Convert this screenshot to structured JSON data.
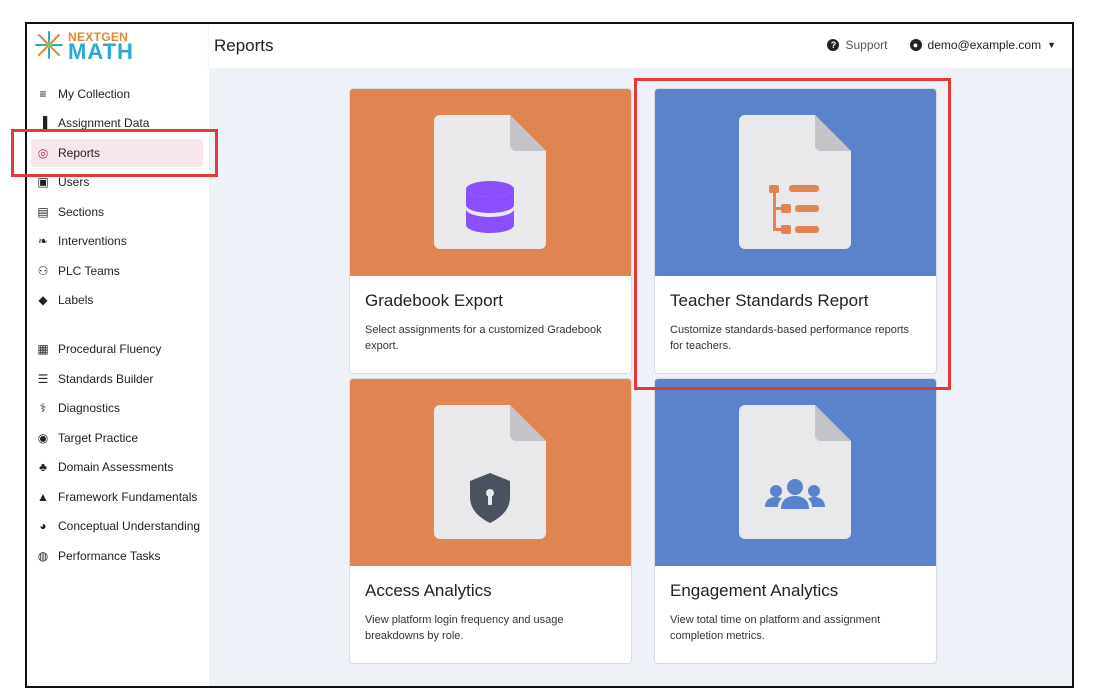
{
  "app": {
    "logo_top": "NEXTGEN",
    "logo_bottom": "MATH",
    "page_title": "Reports"
  },
  "topbar": {
    "support_label": "Support",
    "user_email": "demo@example.com"
  },
  "sidebar": {
    "items": [
      {
        "label": "My Collection",
        "icon": "library-icon",
        "glyph": "≡"
      },
      {
        "label": "Assignment Data",
        "icon": "bar-chart-icon",
        "glyph": "▐"
      },
      {
        "label": "Reports",
        "icon": "magnify-chart-icon",
        "glyph": "◎",
        "active": true
      },
      {
        "label": "Users",
        "icon": "id-card-icon",
        "glyph": "▣"
      },
      {
        "label": "Sections",
        "icon": "chalkboard-icon",
        "glyph": "▤"
      },
      {
        "label": "Interventions",
        "icon": "helping-hand-icon",
        "glyph": "❧"
      },
      {
        "label": "PLC Teams",
        "icon": "users-icon",
        "glyph": "⚇"
      },
      {
        "label": "Labels",
        "icon": "tag-icon",
        "glyph": "◆"
      },
      {
        "label": "Procedural Fluency",
        "icon": "grid-icon",
        "glyph": "▦"
      },
      {
        "label": "Standards Builder",
        "icon": "list-tree-icon",
        "glyph": "☰"
      },
      {
        "label": "Diagnostics",
        "icon": "stethoscope-icon",
        "glyph": "⚕"
      },
      {
        "label": "Target Practice",
        "icon": "target-icon",
        "glyph": "◉"
      },
      {
        "label": "Domain Assessments",
        "icon": "cubes-icon",
        "glyph": "♣"
      },
      {
        "label": "Framework Fundamentals",
        "icon": "shapes-icon",
        "glyph": "▲"
      },
      {
        "label": "Conceptual Understanding",
        "icon": "brain-icon",
        "glyph": "◕"
      },
      {
        "label": "Performance Tasks",
        "icon": "globe-icon",
        "glyph": "◍"
      }
    ]
  },
  "cards": [
    {
      "title": "Gradebook Export",
      "desc": "Select assignments for a customized Gradebook export.",
      "color": "#e08551",
      "icon": "database-icon"
    },
    {
      "title": "Teacher Standards Report",
      "desc": "Customize standards-based performance reports for teachers.",
      "color": "#5a83cc",
      "icon": "list-tree-icon"
    },
    {
      "title": "Access Analytics",
      "desc": "View platform login frequency and usage breakdowns by role.",
      "color": "#e08551",
      "icon": "shield-keyhole-icon"
    },
    {
      "title": "Engagement Analytics",
      "desc": "View total time on platform and assignment completion metrics.",
      "color": "#5a83cc",
      "icon": "users-icon"
    }
  ],
  "colors": {
    "accent_red": "#e03a3a",
    "orange": "#e08551",
    "blue": "#5a83cc",
    "purple": "#8a4dff",
    "active_bg": "#f7e6ea"
  }
}
